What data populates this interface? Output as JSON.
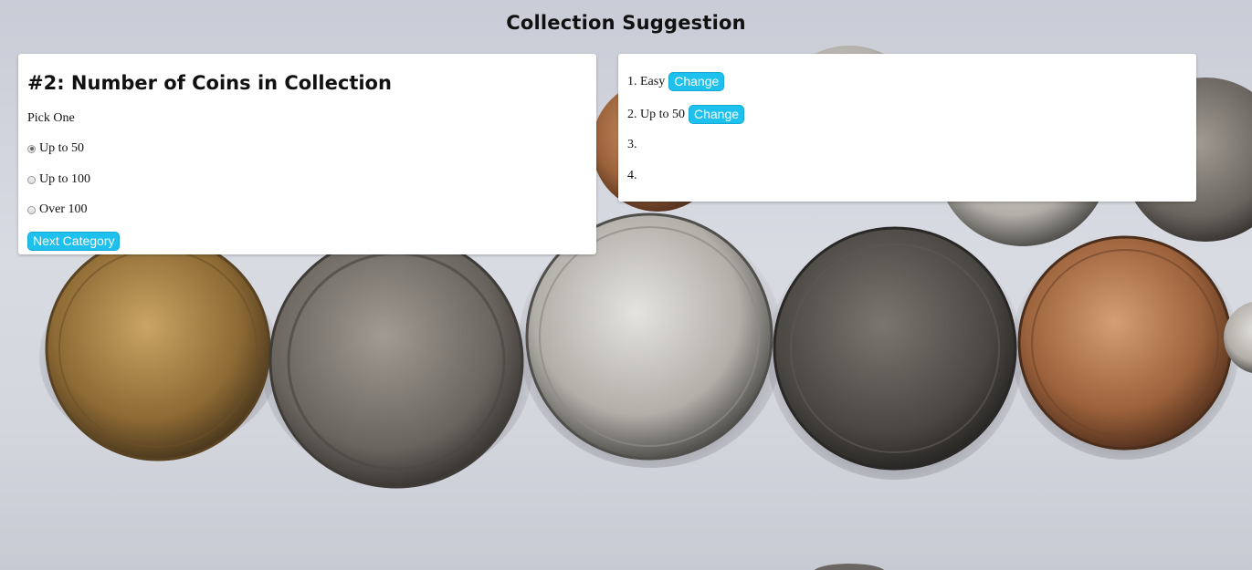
{
  "page": {
    "title": "Collection Suggestion"
  },
  "question": {
    "heading": "#2: Number of Coins in Collection",
    "prompt": "Pick One",
    "options": [
      {
        "label": "Up to 50",
        "checked": true
      },
      {
        "label": "Up to 100",
        "checked": false
      },
      {
        "label": "Over 100",
        "checked": false
      }
    ],
    "next_label": "Next Category"
  },
  "selections": {
    "items": [
      {
        "number": "1.",
        "value": "Easy",
        "action": "Change"
      },
      {
        "number": "2.",
        "value": "Up to 50",
        "action": "Change"
      },
      {
        "number": "3.",
        "value": "",
        "action": ""
      },
      {
        "number": "4.",
        "value": "",
        "action": ""
      }
    ]
  },
  "colors": {
    "button": "#1ec0ee",
    "panel": "#ffffff"
  }
}
